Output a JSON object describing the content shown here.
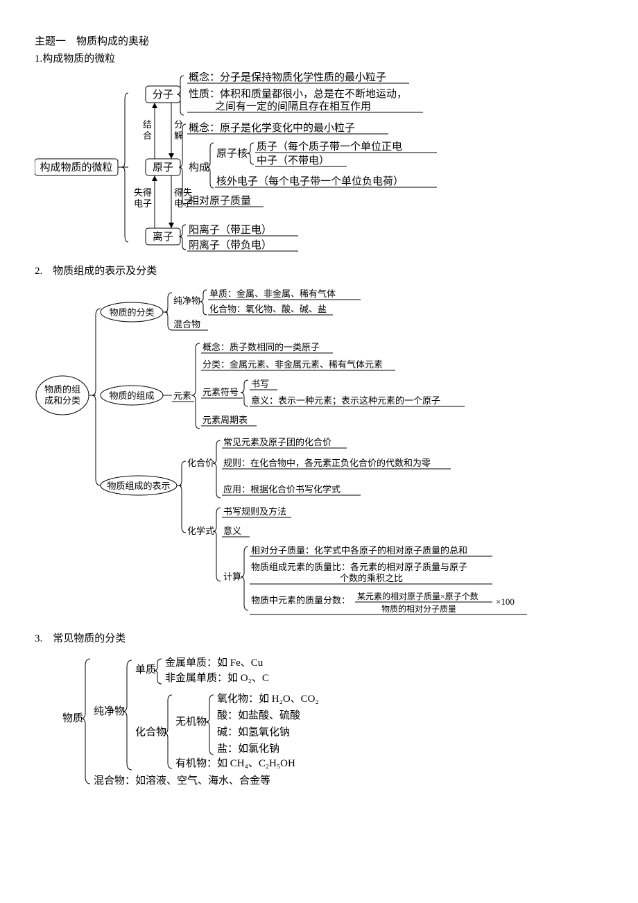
{
  "title": "主题一　物质构成的奥秘",
  "s1": "1.构成物质的微粒",
  "d1": {
    "root": "构成物质的微粒",
    "mol": "分子",
    "atom": "原子",
    "ion": "离子",
    "combine": "结合",
    "decomp": "分解",
    "lose": "失得电子",
    "gain": "得失电子",
    "mol_concept": "概念：分子是保持物质化学性质的最小粒子",
    "mol_prop1": "性质：体积和质量都很小，总是在不断地运动，",
    "mol_prop2": "之间有一定的间隔且存在相互作用",
    "atom_concept": "概念：原子是化学变化中的最小粒子",
    "compose": "构成",
    "nucleus": "原子核",
    "proton": "质子（每个质子带一个单位正电",
    "neutron": "中子（不带电）",
    "electron": "核外电子（每个电子带一个单位负电荷）",
    "relmass": "相对原子质量",
    "cation": "阳离子（带正电）",
    "anion": "阴离子（带负电）"
  },
  "s2": "2.　物质组成的表示及分类",
  "d2": {
    "root1": "物质的组",
    "root2": "成和分类",
    "cls": "物质的分类",
    "comp": "物质的组成",
    "rep": "物质组成的表示",
    "pure": "纯净物",
    "mix": "混合物",
    "simple": "单质：金属、非金属、稀有气体",
    "compound": "化合物：氧化物、酸、碱、盐",
    "elem": "元素",
    "elem_concept": "概念：质子数相同的一类原子",
    "elem_cls": "分类：金属元素、非金属元素、稀有气体元素",
    "symbol": "元素符号",
    "write": "书写",
    "meaning": "意义：表示一种元素；表示这种元素的一个原子",
    "ptable": "元素周期表",
    "valence": "化合价",
    "common": "常见元素及原子团的化合价",
    "rule": "规则：在化合物中，各元素正负化合价的代数和为零",
    "app": "应用：根据化合价书写化学式",
    "formula": "化学式",
    "wrule": "书写规则及方法",
    "fmean": "意义",
    "calc": "计算",
    "relmm": "相对分子质量：化学式中各原子的相对原子质量的总和",
    "ratio1": "物质组成元素的质量比：各元素的相对原子质量与原子",
    "ratio2": "个数的乘积之比",
    "frac0": "物质中元素的质量分数：",
    "frac1": "某元素的相对原子质量×原子个数",
    "frac2": "物质的相对分子质量",
    "times100": "×100"
  },
  "s3": "3.　常见物质的分类",
  "d3": {
    "matter": "物质",
    "pure": "纯净物",
    "mix": "混合物：如溶液、空气、海水、合金等",
    "simple": "单质",
    "compound": "化合物",
    "metal": "金属单质：如 Fe、Cu",
    "nonmetal": "非金属单质：如 O₂、C",
    "inorg": "无机物",
    "org": "有机物：如 CH₄、C₂H₅OH",
    "oxide": "氧化物：如 H₂O、CO₂",
    "acid": "酸：如盐酸、硫酸",
    "base": "碱：如氢氧化钠",
    "salt": "盐：如氯化钠"
  }
}
